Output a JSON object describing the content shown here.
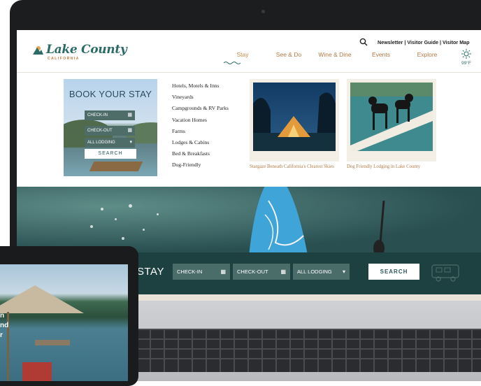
{
  "header": {
    "logo_text": "Lake County",
    "logo_sub": "CALIFORNIA",
    "utility_links": "Newsletter | Visitor Guide | Visitor Map",
    "nav": [
      "Stay",
      "See & Do",
      "Wine & Dine",
      "Events",
      "Explore"
    ],
    "temperature": "99°F"
  },
  "book_card": {
    "title": "BOOK YOUR STAY",
    "check_in": "CHECK-IN",
    "check_out": "CHECK-OUT",
    "lodging": "ALL LODGING",
    "search": "SEARCH"
  },
  "lodging_links": [
    "Hotels, Motels & Inns",
    "Vineyards",
    "Campgrounds & RV Parks",
    "Vacation Homes",
    "Farms",
    "Lodges & Cabins",
    "Bed & Breakfasts",
    "Dog-Friendly"
  ],
  "features": [
    {
      "caption": "Stargaze Beneath California's Clearest Skies"
    },
    {
      "caption": "Dog Friendly Lodging in Lake County"
    }
  ],
  "booking_bar": {
    "title": "STAY",
    "check_in": "CHECK-IN",
    "check_out": "CHECK-OUT",
    "lodging": "ALL LODGING",
    "search": "SEARCH"
  },
  "tablet": {
    "line1": "n",
    "line2": "nd",
    "line3": "r"
  },
  "colors": {
    "teal": "#2c6b67",
    "accent": "#b07a47",
    "bar": "#1d4140"
  }
}
